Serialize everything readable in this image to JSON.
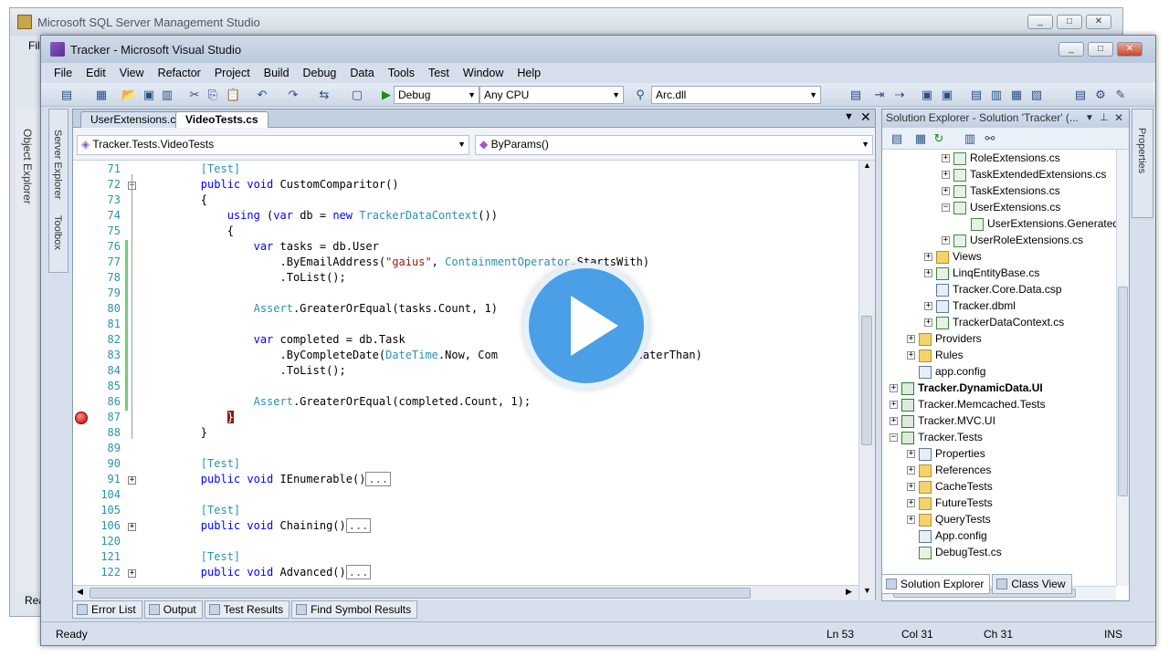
{
  "ssms": {
    "title": "Microsoft SQL Server Management Studio",
    "menu_fragment": "Fil",
    "side_label": "Object Explorer",
    "status_fragment": "Rea"
  },
  "vs": {
    "title": "Tracker - Microsoft Visual Studio",
    "menu": [
      "File",
      "Edit",
      "View",
      "Refactor",
      "Project",
      "Build",
      "Debug",
      "Data",
      "Tools",
      "Test",
      "Window",
      "Help"
    ],
    "toolbar": {
      "config": "Debug",
      "platform": "Any CPU",
      "find_target": "Arc.dll"
    },
    "side_panels": {
      "server_explorer": "Server Explorer",
      "toolbox": "Toolbox",
      "properties": "Properties"
    }
  },
  "editor": {
    "tabs": [
      {
        "label": "UserExtensions.cs",
        "active": false
      },
      {
        "label": "VideoTests.cs",
        "active": true
      }
    ],
    "nav_class": "Tracker.Tests.VideoTests",
    "nav_member": "ByParams()",
    "lines": [
      {
        "n": "71",
        "html": "        <span class=\"at\">[Test]</span>"
      },
      {
        "n": "72",
        "html": "        <span class=\"kw\">public void</span> CustomComparitor()"
      },
      {
        "n": "73",
        "html": "        {"
      },
      {
        "n": "74",
        "html": "            <span class=\"kw\">using</span> (<span class=\"kw\">var</span> db = <span class=\"kw\">new</span> <span class=\"ty\">TrackerDataContext</span>())"
      },
      {
        "n": "75",
        "html": "            {"
      },
      {
        "n": "76",
        "html": "                <span class=\"kw\">var</span> tasks = db.User"
      },
      {
        "n": "77",
        "html": "                    .ByEmailAddress(<span class=\"st\">\"gaius\"</span>, <span class=\"ty\">ContainmentOperator</span>.StartsWith)"
      },
      {
        "n": "78",
        "html": "                    .ToList();"
      },
      {
        "n": "79",
        "html": ""
      },
      {
        "n": "80",
        "html": "                <span class=\"ty\">Assert</span>.GreaterOrEqual(tasks.Count, 1)"
      },
      {
        "n": "81",
        "html": ""
      },
      {
        "n": "82",
        "html": "                <span class=\"kw\">var</span> completed = db.Task"
      },
      {
        "n": "83",
        "html": "                    .ByCompleteDate(<span class=\"ty\">DateTime</span>.Now, Com                   GreaterThan)"
      },
      {
        "n": "84",
        "html": "                    .ToList();"
      },
      {
        "n": "85",
        "html": ""
      },
      {
        "n": "86",
        "html": "                <span class=\"ty\">Assert</span>.GreaterOrEqual(completed.Count, 1);"
      },
      {
        "n": "87",
        "html": "            <span style=\"background:#8b1a1a;color:#fff\">}</span>"
      },
      {
        "n": "88",
        "html": "        }"
      },
      {
        "n": "89",
        "html": ""
      },
      {
        "n": "90",
        "html": "        <span class=\"at\">[Test]</span>"
      },
      {
        "n": "91",
        "html": "        <span class=\"kw\">public void</span> IEnumerable()<span class=\"collapsed\">...</span>"
      },
      {
        "n": "104",
        "html": ""
      },
      {
        "n": "105",
        "html": "        <span class=\"at\">[Test]</span>"
      },
      {
        "n": "106",
        "html": "        <span class=\"kw\">public void</span> Chaining()<span class=\"collapsed\">...</span>"
      },
      {
        "n": "120",
        "html": ""
      },
      {
        "n": "121",
        "html": "        <span class=\"at\">[Test]</span>"
      },
      {
        "n": "122",
        "html": "        <span class=\"kw\">public void</span> Advanced()<span class=\"collapsed\">...</span>"
      }
    ]
  },
  "solution_explorer": {
    "title": "Solution Explorer - Solution 'Tracker' (...",
    "items": [
      {
        "label": "RoleExtensions.cs",
        "depth": 4,
        "icon": "cs",
        "exp": "+"
      },
      {
        "label": "TaskExtendedExtensions.cs",
        "depth": 4,
        "icon": "cs",
        "exp": "+"
      },
      {
        "label": "TaskExtensions.cs",
        "depth": 4,
        "icon": "cs",
        "exp": "+"
      },
      {
        "label": "UserExtensions.cs",
        "depth": 4,
        "icon": "cs",
        "exp": "-"
      },
      {
        "label": "UserExtensions.Generated.cs",
        "depth": 5,
        "icon": "cs",
        "exp": ""
      },
      {
        "label": "UserRoleExtensions.cs",
        "depth": 4,
        "icon": "cs",
        "exp": "+"
      },
      {
        "label": "Views",
        "depth": 3,
        "icon": "folder",
        "exp": "+"
      },
      {
        "label": "LinqEntityBase.cs",
        "depth": 3,
        "icon": "cs",
        "exp": "+"
      },
      {
        "label": "Tracker.Core.Data.csp",
        "depth": 3,
        "icon": "cfg",
        "exp": ""
      },
      {
        "label": "Tracker.dbml",
        "depth": 3,
        "icon": "cfg",
        "exp": "+"
      },
      {
        "label": "TrackerDataContext.cs",
        "depth": 3,
        "icon": "cs",
        "exp": "+"
      },
      {
        "label": "Providers",
        "depth": 2,
        "icon": "folder",
        "exp": "+"
      },
      {
        "label": "Rules",
        "depth": 2,
        "icon": "folder",
        "exp": "+"
      },
      {
        "label": "app.config",
        "depth": 2,
        "icon": "cfg",
        "exp": ""
      },
      {
        "label": "Tracker.DynamicData.UI",
        "depth": 1,
        "icon": "proj",
        "exp": "+",
        "bold": true
      },
      {
        "label": "Tracker.Memcached.Tests",
        "depth": 1,
        "icon": "proj",
        "exp": "+"
      },
      {
        "label": "Tracker.MVC.UI",
        "depth": 1,
        "icon": "proj",
        "exp": "+"
      },
      {
        "label": "Tracker.Tests",
        "depth": 1,
        "icon": "proj",
        "exp": "-"
      },
      {
        "label": "Properties",
        "depth": 2,
        "icon": "cfg",
        "exp": "+"
      },
      {
        "label": "References",
        "depth": 2,
        "icon": "folder",
        "exp": "+"
      },
      {
        "label": "CacheTests",
        "depth": 2,
        "icon": "folder",
        "exp": "+"
      },
      {
        "label": "FutureTests",
        "depth": 2,
        "icon": "folder",
        "exp": "+"
      },
      {
        "label": "QueryTests",
        "depth": 2,
        "icon": "folder",
        "exp": "+"
      },
      {
        "label": "App.config",
        "depth": 2,
        "icon": "cfg",
        "exp": ""
      },
      {
        "label": "DebugTest.cs",
        "depth": 2,
        "icon": "cs",
        "exp": ""
      }
    ],
    "tabs": [
      "Solution Explorer",
      "Class View"
    ]
  },
  "bottom_tabs": [
    "Error List",
    "Output",
    "Test Results",
    "Find Symbol Results"
  ],
  "status": {
    "state": "Ready",
    "ln": "Ln 53",
    "col": "Col 31",
    "ch": "Ch 31",
    "mode": "INS"
  },
  "colors": {
    "play_button": "#4a9fe6",
    "keyword": "#0000ff",
    "type": "#2b91af",
    "string": "#a31515"
  }
}
